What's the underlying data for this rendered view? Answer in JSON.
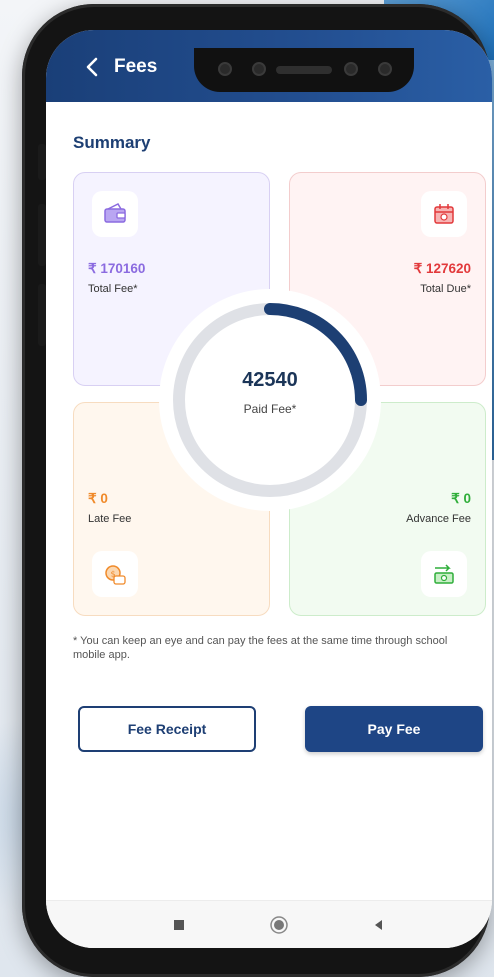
{
  "colors": {
    "appbar": "#1f4a8a",
    "accent": "#1e4585",
    "total_fee": "#8b6be0",
    "total_due": "#e2393b",
    "late_fee": "#f08a2a",
    "advance_fee": "#2fae3a",
    "ring_track": "#dfe1e6",
    "ring_fill": "#1d3f73"
  },
  "header": {
    "back_icon": "chevron-left-icon",
    "title": "Fees"
  },
  "summary": {
    "title": "Summary",
    "total_fee": {
      "icon": "wallet-icon",
      "amount": "₹ 170160",
      "label": "Total Fee*"
    },
    "total_due": {
      "icon": "calendar-money-icon",
      "amount": "₹ 127620",
      "label": "Total Due*"
    },
    "late_fee": {
      "icon": "money-clock-icon",
      "amount": "₹ 0",
      "label": "Late Fee"
    },
    "advance_fee": {
      "icon": "cash-transfer-icon",
      "amount": "₹ 0",
      "label": "Advance Fee"
    },
    "paid": {
      "value": "42540",
      "label": "Paid Fee*",
      "fraction": 0.25
    }
  },
  "note": "* You can keep an eye and can pay the fees at the same time  through school mobile app.",
  "buttons": {
    "receipt": "Fee Receipt",
    "pay": "Pay Fee"
  },
  "navbar": {
    "items": [
      "recent-apps-icon",
      "home-icon",
      "back-icon"
    ]
  }
}
